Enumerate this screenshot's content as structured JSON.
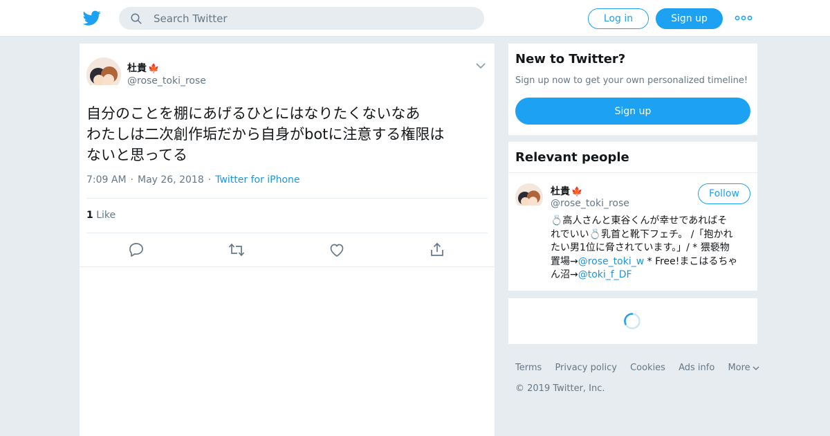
{
  "header": {
    "search_placeholder": "Search Twitter",
    "login_label": "Log in",
    "signup_label": "Sign up",
    "logo_icon": "twitter-bird-icon",
    "more_icon": "more-dots-icon"
  },
  "tweet": {
    "display_name": "杜貴",
    "flag_emoji": "🍁",
    "handle": "@rose_toki_rose",
    "text_lines": [
      "自分のことを棚にあげるひとにはなりたくないなあ",
      "わたしは二次創作垢だから自身がbotに注意する権限は",
      "ないと思ってる"
    ],
    "time": "7:09 AM",
    "date": "May 26, 2018",
    "source": "Twitter for iPhone",
    "like_count": "1",
    "like_label": "Like"
  },
  "sidebar": {
    "new_title": "New to Twitter?",
    "new_subtitle": "Sign up now to get your own personalized timeline!",
    "signup_button": "Sign up",
    "relevant_title": "Relevant people",
    "person": {
      "display_name": "杜貴",
      "flag_emoji": "🍁",
      "handle": "@rose_toki_rose",
      "follow_label": "Follow",
      "bio_lines": {
        "l1": "💍高人さんと東谷くんが幸せであればそ",
        "l2": "れでいい💍乳首と靴下フェチ。 /「抱かれ",
        "l3": "たい男1位に脅されています。」/ * 猥褻物",
        "l4_pre": "置場→",
        "l4_link": "@rose_toki_w",
        "l4_post": " *  Free!まこはるちゃ",
        "l5_pre": "ん沼→",
        "l5_link": "@toki_f_DF"
      }
    }
  },
  "footer": {
    "links": [
      "Terms",
      "Privacy policy",
      "Cookies",
      "Ads info",
      "More"
    ],
    "copyright": "© 2019 Twitter, Inc."
  },
  "colors": {
    "accent": "#1da1f2",
    "link": "#1b95e0",
    "background": "#e6ecf0",
    "muted_text": "#657786"
  }
}
